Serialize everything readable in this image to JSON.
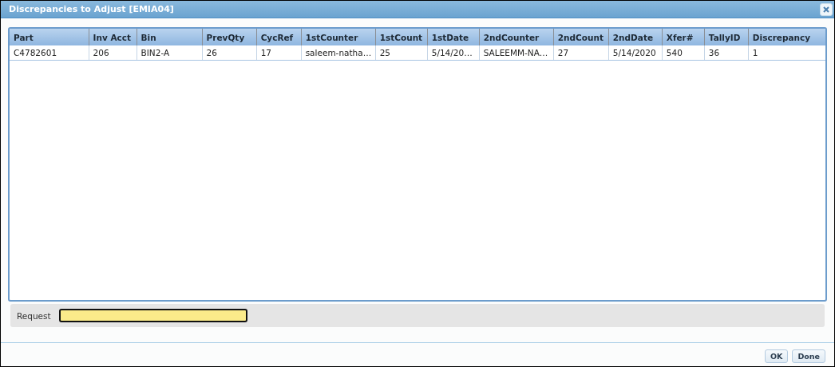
{
  "window": {
    "title": "Discrepancies to Adjust [EMIA04]"
  },
  "table": {
    "columns": [
      "Part",
      "Inv Acct",
      "Bin",
      "PrevQty",
      "CycRef",
      "1stCounter",
      "1stCount",
      "1stDate",
      "2ndCounter",
      "2ndCount",
      "2ndDate",
      "Xfer#",
      "TallyID",
      "Discrepancy"
    ],
    "rows": [
      [
        "C4782601",
        "206",
        "BIN2-A",
        "26",
        "17",
        "saleem-natha…",
        "25",
        "5/14/20…",
        "SALEEMM-NA…",
        "27",
        "5/14/2020",
        "540",
        "36",
        "1"
      ]
    ]
  },
  "request": {
    "label": "Request"
  },
  "buttons": [
    "OK",
    "Done"
  ]
}
